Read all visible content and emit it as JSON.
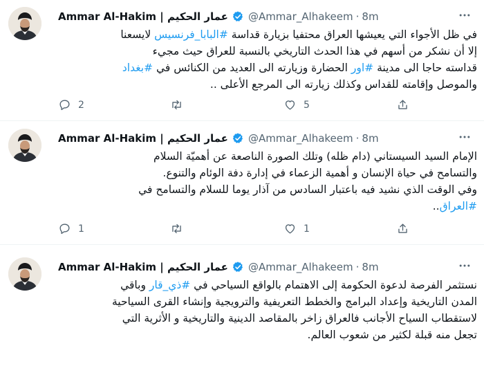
{
  "tweets": [
    {
      "name": "Ammar Al-Hakim | عمار الحكيم",
      "handle": "@Ammar_Alhakeem",
      "time": "8m",
      "lines": [
        [
          {
            "t": "في ظل الأجواء التي يعيشها العراق محتفيا بزيارة قداسة "
          },
          {
            "t": "#البابا_فرنسيس",
            "link": true
          },
          {
            "t": " لايسعنا"
          }
        ],
        [
          {
            "t": "إلا أن نشكر من أسهم في هذا الحدث التاريخي بالنسبة للعراق حيث مجيء"
          }
        ],
        [
          {
            "t": "قداسته حاجا الى مدينة "
          },
          {
            "t": "#اور",
            "link": true
          },
          {
            "t": " الحضارة وزيارته الى العديد من الكنائس في "
          },
          {
            "t": "#بغداد",
            "link": true
          }
        ],
        [
          {
            "t": "والموصل وإقامته للقداس وكذلك زيارته الى المرجع الأعلى .."
          }
        ]
      ],
      "replies": "2",
      "retweets": "",
      "likes": "5"
    },
    {
      "name": "Ammar Al-Hakim | عمار الحكيم",
      "handle": "@Ammar_Alhakeem",
      "time": "8m",
      "lines": [
        [
          {
            "t": "الإمام السيد السيستاني (دام ظله) وتلك الصورة الناصعة عن أهميّة السلام"
          }
        ],
        [
          {
            "t": "والتسامح في حياة الإنسان و أهمية الزعماء في إدارة دفة الوئام والتنوع."
          }
        ],
        [
          {
            "t": "وفي الوقت الذي نشيد فيه باعتبار السادس من آذار يوما للسلام والتسامح في"
          }
        ],
        [
          {
            "t": "#العراق",
            "link": true
          },
          {
            "t": ".."
          }
        ]
      ],
      "replies": "1",
      "retweets": "",
      "likes": "1"
    },
    {
      "name": "Ammar Al-Hakim | عمار الحكيم",
      "handle": "@Ammar_Alhakeem",
      "time": "8m",
      "lines": [
        [
          {
            "t": "نستثمر الفرصة لدعوة الحكومة إلى الاهتمام بالواقع السياحي في "
          },
          {
            "t": "#ذي_قار",
            "link": true
          },
          {
            "t": " وباقي"
          }
        ],
        [
          {
            "t": "المدن التاريخية وإعداد البرامج والخطط التعريفية والترويجية وإنشاء القرى السياحية"
          }
        ],
        [
          {
            "t": "لاستقطاب السياح الأجانب فالعراق زاخر بالمقاصد الدينية والتاريخية و الأثرية التي"
          }
        ],
        [
          {
            "t": "تجعل منه قبلة لكثير من شعوب العالم."
          }
        ]
      ],
      "replies": "",
      "retweets": "",
      "likes": ""
    }
  ],
  "colors": {
    "accent": "#1d9bf0",
    "text": "#0f1419",
    "muted": "#536471",
    "divider": "#eff3f4"
  },
  "icons": [
    "verified-badge-icon",
    "reply-icon",
    "retweet-icon",
    "like-icon",
    "share-icon",
    "more-icon"
  ]
}
